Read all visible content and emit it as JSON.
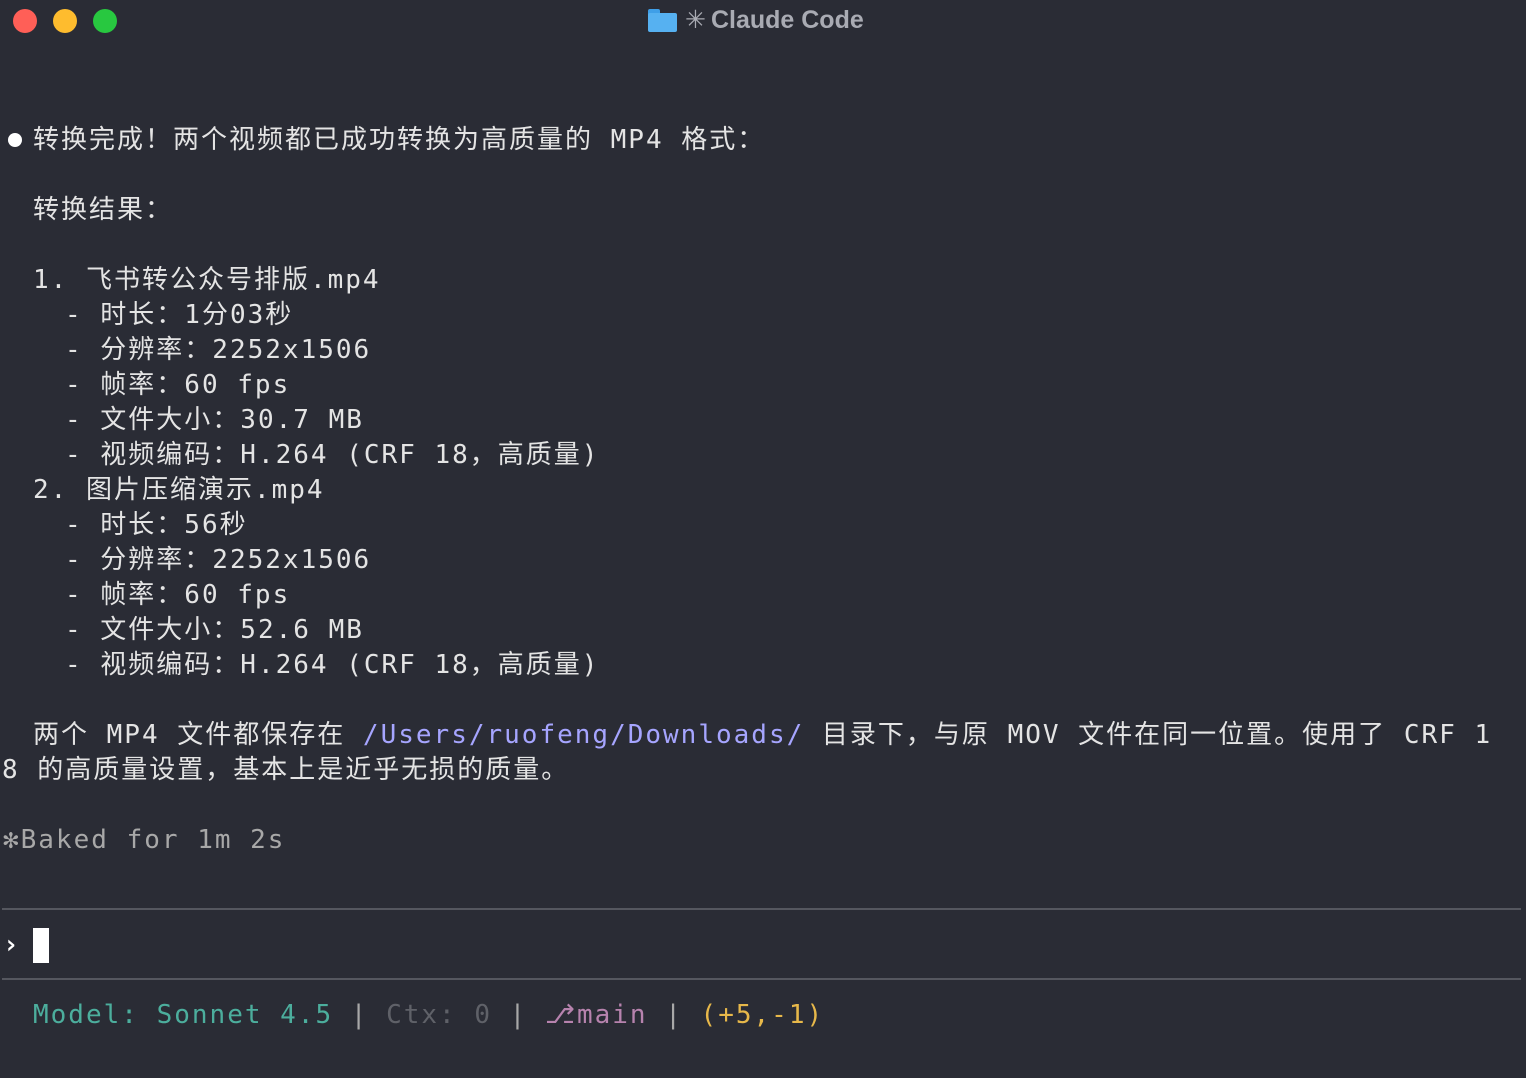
{
  "window": {
    "title": "Claude Code",
    "title_star": "✳",
    "traffic_lights": {
      "close": "#ff5f57",
      "minimize": "#febc2e",
      "zoom": "#28c840"
    }
  },
  "message": {
    "headline": "转换完成！两个视频都已成功转换为高质量的 MP4 格式：",
    "section_title": "转换结果：",
    "files": [
      {
        "name": "1. 飞书转公众号排版.mp4",
        "details": [
          "- 时长：1分03秒",
          "- 分辨率：2252x1506",
          "- 帧率：60 fps",
          "- 文件大小：30.7 MB",
          "- 视频编码：H.264 (CRF 18，高质量)"
        ]
      },
      {
        "name": "2. 图片压缩演示.mp4",
        "details": [
          "- 时长：56秒",
          "- 分辨率：2252x1506",
          "- 帧率：60 fps",
          "- 文件大小：52.6 MB",
          "- 视频编码：H.264 (CRF 18，高质量)"
        ]
      }
    ],
    "summary_part1": "两个 MP4 文件都保存在 ",
    "summary_path": "/Users/ruofeng/Downloads/",
    "summary_part2": " 目录下，与原 MOV 文件在同一位置。使用了 CRF 1",
    "summary_line2": "8 的高质量设置，基本上是近乎无损的质量。"
  },
  "timing": {
    "star": "✻",
    "text": "Baked for 1m 2s"
  },
  "prompt": {
    "symbol": "›",
    "value": ""
  },
  "statusbar": {
    "model_label": "Model: ",
    "model_value": "Sonnet 4.5",
    "sep": " | ",
    "ctx": "Ctx: 0",
    "branch_icon": "⎇",
    "branch": "main",
    "diff": "(+5,-1)"
  }
}
